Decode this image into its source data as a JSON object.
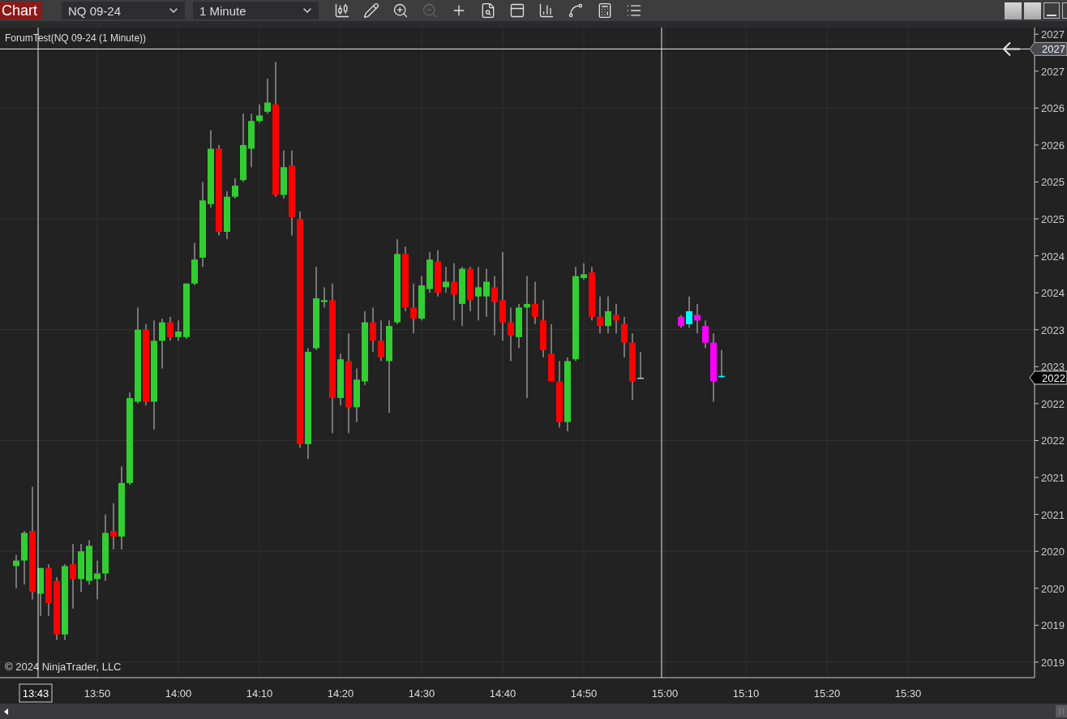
{
  "toolbar": {
    "title": "Chart",
    "instrument": "NQ 09-24",
    "interval": "1 Minute",
    "buttons": [
      {
        "kind": "bars",
        "disabled": false
      },
      {
        "kind": "draw",
        "disabled": false
      },
      {
        "kind": "zoom_in",
        "disabled": false
      },
      {
        "kind": "zoom_out",
        "disabled": true
      },
      {
        "kind": "crosshair",
        "disabled": false
      },
      {
        "kind": "data_box",
        "disabled": false
      },
      {
        "kind": "trade",
        "disabled": false
      },
      {
        "kind": "indicators",
        "disabled": false
      },
      {
        "kind": "strategies",
        "disabled": false
      },
      {
        "kind": "calculator",
        "disabled": false
      },
      {
        "kind": "properties",
        "disabled": false
      }
    ]
  },
  "chart": {
    "indicator_label": "ForumTest(NQ 09-24 (1 Minute))",
    "copyright": "© 2024 NinjaTrader, LLC",
    "price_axis": [
      "2027",
      "2027",
      "2026",
      "2026",
      "2025",
      "2025",
      "2024",
      "2024",
      "2023",
      "2023",
      "2022",
      "2022",
      "2021",
      "2021",
      "2020",
      "2020",
      "2019",
      "2019"
    ],
    "time_axis": [
      "13:50",
      "14:00",
      "14:10",
      "14:20",
      "14:30",
      "14:40",
      "14:50",
      "15:00",
      "15:10",
      "15:20",
      "15:30"
    ],
    "crosshair": {
      "price_label": "2027",
      "time_label": "13:43"
    },
    "last_price_label": "2022"
  }
}
